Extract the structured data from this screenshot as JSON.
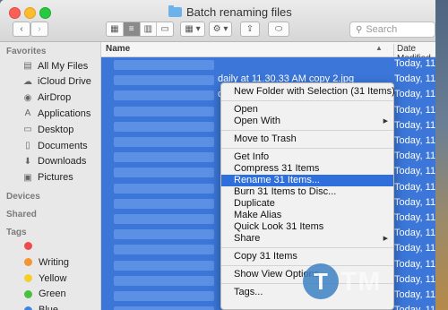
{
  "window": {
    "title": "Batch renaming files",
    "nav_back": "‹",
    "nav_forward": "›",
    "search_placeholder": "Search"
  },
  "toolbar": {
    "view_icons": [
      "icon-view-icon",
      "list-view-icon",
      "column-view-icon",
      "cover-flow-icon"
    ],
    "arrange": "▦ ▾",
    "action": "⚙ ▾",
    "share": "⇪",
    "tag": "⬭"
  },
  "sidebar": {
    "favorites_header": "Favorites",
    "favorites": [
      {
        "label": "All My Files",
        "icon": "all-files-icon",
        "glyph": "▤"
      },
      {
        "label": "iCloud Drive",
        "icon": "cloud-icon",
        "glyph": "☁"
      },
      {
        "label": "AirDrop",
        "icon": "airdrop-icon",
        "glyph": "◉"
      },
      {
        "label": "Applications",
        "icon": "applications-icon",
        "glyph": "A"
      },
      {
        "label": "Desktop",
        "icon": "desktop-icon",
        "glyph": "▭"
      },
      {
        "label": "Documents",
        "icon": "documents-icon",
        "glyph": "▯"
      },
      {
        "label": "Downloads",
        "icon": "downloads-icon",
        "glyph": "⬇"
      },
      {
        "label": "Pictures",
        "icon": "pictures-icon",
        "glyph": "▣"
      }
    ],
    "devices_header": "Devices",
    "shared_header": "Shared",
    "tags_header": "Tags",
    "tags": [
      {
        "label": "",
        "color": "#f04b4b"
      },
      {
        "label": "Writing",
        "color": "#f3962f"
      },
      {
        "label": "Yellow",
        "color": "#f4cf2a"
      },
      {
        "label": "Green",
        "color": "#47c13f"
      },
      {
        "label": "Blue",
        "color": "#3a86e6"
      }
    ]
  },
  "file_list": {
    "col_name": "Name",
    "col_date": "Date Modified",
    "sort_indicator": "▲",
    "rows": [
      {
        "name": "",
        "date": "Today, 11"
      },
      {
        "name": "daily at 11.30.33 AM copy 2.jpg",
        "date": "Today, 11"
      },
      {
        "name": "daily at 11.30.33 AM copy 3.jpg",
        "date": "Today, 11"
      },
      {
        "name": "",
        "date": "Today, 11"
      },
      {
        "name": "",
        "date": "Today, 11"
      },
      {
        "name": "",
        "date": "Today, 11"
      },
      {
        "name": "",
        "date": "Today, 11"
      },
      {
        "name": "",
        "date": "Today, 11"
      },
      {
        "name": "",
        "date": "Today, 11"
      },
      {
        "name": "",
        "date": "Today, 11"
      },
      {
        "name": "",
        "date": "Today, 11"
      },
      {
        "name": "",
        "date": "Today, 11"
      },
      {
        "name": "",
        "date": "Today, 11"
      },
      {
        "name": "",
        "date": "Today, 11"
      },
      {
        "name": "",
        "date": "Today, 11"
      },
      {
        "name": "",
        "date": "Today, 11"
      },
      {
        "name": "",
        "date": "Today, 11"
      }
    ]
  },
  "context_menu": {
    "items": [
      {
        "label": "New Folder with Selection (31 Items)",
        "name": "menu-new-folder-with-selection"
      },
      {
        "sep": true
      },
      {
        "label": "Open",
        "name": "menu-open"
      },
      {
        "label": "Open With",
        "name": "menu-open-with",
        "submenu": true
      },
      {
        "sep": true
      },
      {
        "label": "Move to Trash",
        "name": "menu-move-to-trash"
      },
      {
        "sep": true
      },
      {
        "label": "Get Info",
        "name": "menu-get-info"
      },
      {
        "label": "Compress 31 Items",
        "name": "menu-compress"
      },
      {
        "label": "Rename 31 Items...",
        "name": "menu-rename",
        "highlighted": true
      },
      {
        "label": "Burn 31 Items to Disc...",
        "name": "menu-burn"
      },
      {
        "label": "Duplicate",
        "name": "menu-duplicate"
      },
      {
        "label": "Make Alias",
        "name": "menu-make-alias"
      },
      {
        "label": "Quick Look 31 Items",
        "name": "menu-quick-look"
      },
      {
        "label": "Share",
        "name": "menu-share",
        "submenu": true
      },
      {
        "sep": true
      },
      {
        "label": "Copy 31 Items",
        "name": "menu-copy"
      },
      {
        "sep": true
      },
      {
        "label": "Show View Options",
        "name": "menu-show-view-options"
      },
      {
        "sep": true
      },
      {
        "label": "Tags...",
        "name": "menu-tags"
      }
    ],
    "submenu_arrow": "▶"
  },
  "watermark": {
    "letter": "T",
    "text": "TM"
  }
}
